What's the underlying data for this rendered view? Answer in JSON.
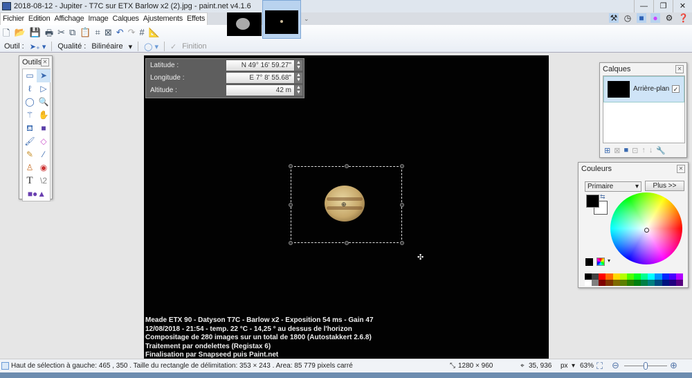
{
  "window": {
    "title": "2018-08-12 - Jupiter - T7C sur ETX Barlow x2 (2).jpg - paint.net v4.1.6",
    "controls": [
      "—",
      "❐",
      "✕"
    ]
  },
  "menu": [
    "Fichier",
    "Edition",
    "Affichage",
    "Image",
    "Calques",
    "Ajustements",
    "Effets"
  ],
  "toolbar_icons": [
    "new-icon",
    "open-icon",
    "save-icon",
    "print-icon",
    "cut-icon",
    "copy-icon",
    "paste-icon",
    "crop-icon",
    "deselect-icon",
    "undo-icon",
    "redo-icon",
    "grid-icon",
    "ruler-icon"
  ],
  "options": {
    "tool_label": "Outil :",
    "quality_label": "Qualité :",
    "quality_value": "Bilinéaire",
    "finish_label": "Finition"
  },
  "geo": {
    "rows": [
      {
        "label": "Latitude :",
        "value": "N 49° 16' 59.27\""
      },
      {
        "label": "Longitude :",
        "value": "E 7° 8' 55.68\""
      },
      {
        "label": "Altitude :",
        "value": "42 m"
      }
    ]
  },
  "caption": [
    "Meade ETX 90 - Datyson T7C - Barlow x2 - Exposition  54 ms - Gain  47",
    "12/08/2018 - 21:54 - temp. 22 °C - 14,25 ° au dessus de l'horizon",
    "Compositage de 280 images sur un total de 1800 (Autostakkert 2.6.8)",
    "Traitement par ondelettes (Registax 6)",
    "Finalisation par Snapseed puis Paint.net"
  ],
  "tools": {
    "title": "Outils"
  },
  "layers": {
    "title": "Calques",
    "items": [
      {
        "name": "Arrière-plan",
        "visible": true
      }
    ]
  },
  "colors": {
    "title": "Couleurs",
    "mode": "Primaire",
    "more": "Plus >>",
    "primary": "#000000",
    "secondary": "#ffffff",
    "palette_top": [
      "#000000",
      "#404040",
      "#ff0000",
      "#ff6a00",
      "#ffd800",
      "#b6ff00",
      "#4cff00",
      "#00ff21",
      "#00ff90",
      "#00ffff",
      "#0094ff",
      "#0026ff",
      "#4800ff",
      "#b200ff",
      "#ff00dc",
      "#ff006e"
    ],
    "palette_bottom": [
      "#ffffff",
      "#808080",
      "#7f0000",
      "#7f3300",
      "#7f6a00",
      "#5b7f00",
      "#267f00",
      "#007f0e",
      "#007f46",
      "#007f7f",
      "#004a7f",
      "#00137f",
      "#21007f",
      "#57007f",
      "#7f006e",
      "#7f0037"
    ]
  },
  "status": {
    "selection": "Haut de sélection à gauche: 465 , 350 . Taille du rectangle de délimitation: 353  × 243 . Area: 85 779 pixels carré",
    "image_size": "1280 × 960",
    "cursor": "35, 936",
    "units": "px",
    "zoom": "63%",
    "zoom_level": 0.63
  }
}
